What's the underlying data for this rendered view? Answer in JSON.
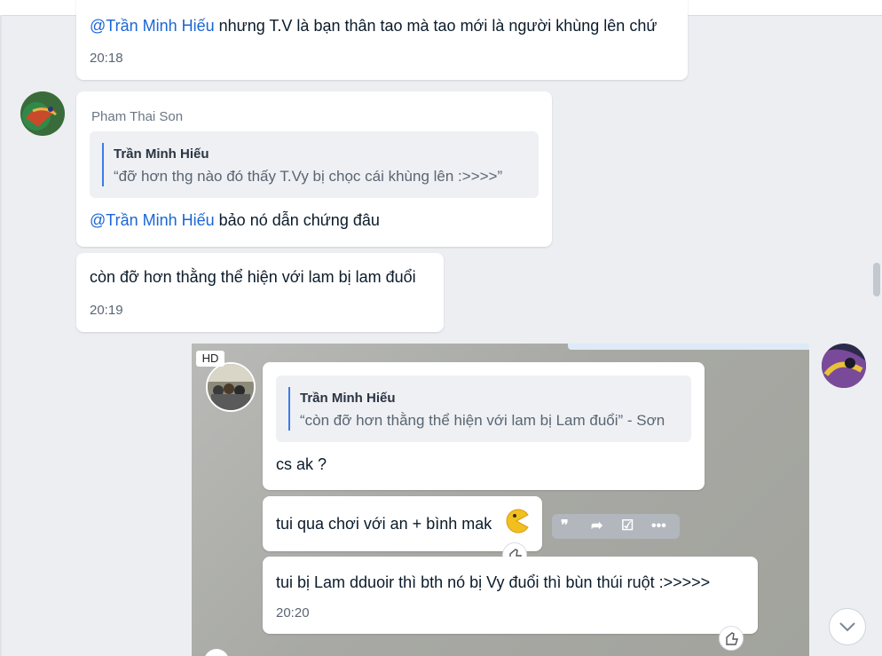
{
  "messages": {
    "m1": {
      "mention": "@Trần Minh Hiếu",
      "text": " nhưng T.V là bạn thân tao mà tao mới là người khùng lên chứ",
      "time": "20:18"
    },
    "m2": {
      "sender": "Pham Thai Son",
      "quote_name": "Trần Minh Hiếu",
      "quote_text": "“đỡ hơn thg nào đó thấy T.Vy bị chọc cái khùng lên :>>>>”",
      "mention": "@Trần Minh Hiếu",
      "text": " bảo nó dẫn chứng đâu"
    },
    "m3": {
      "text": "còn đỡ hơn thằng thể hiện với lam bị lam đuổi",
      "time": "20:19"
    }
  },
  "image": {
    "hd_badge": "HD",
    "inner": {
      "quote_name": "Trần Minh Hiếu",
      "quote_text": "“còn đỡ hơn thằng thể hiện với lam bị Lam đuổi” - Sơn",
      "reply_text": "cs ak ?",
      "msg2_text": "tui qua chơi với an + bình mak",
      "msg2_emoji": "pacman-emoji",
      "msg3_text": "tui bị Lam dduoir thì bth nó bị Vy đuổi thì bùn thúi ruột :>>>>>",
      "msg3_time": "20:20"
    }
  },
  "colors": {
    "mention": "#1a66d6",
    "accent": "#3b7cea",
    "background": "#eceef2"
  }
}
